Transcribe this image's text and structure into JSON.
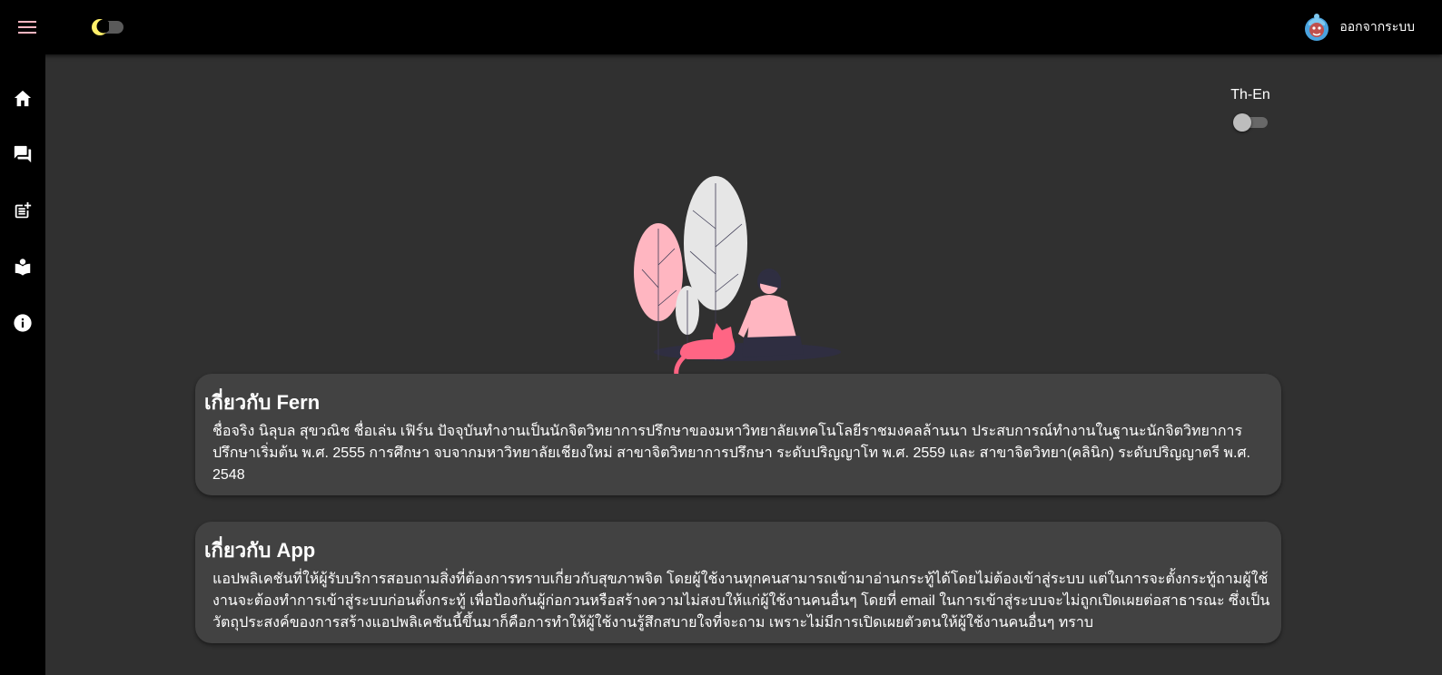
{
  "topbar": {
    "menu_icon": "menu-icon",
    "theme_toggle_icon": "moon-icon",
    "logout_label": "ออกจากระบบ"
  },
  "sidebar": {
    "items": [
      {
        "icon": "home-icon"
      },
      {
        "icon": "forum-icon"
      },
      {
        "icon": "post-add-icon"
      },
      {
        "icon": "local-library-icon"
      },
      {
        "icon": "info-icon"
      }
    ]
  },
  "language": {
    "label": "Th-En"
  },
  "about_fern": {
    "title": "เกี่ยวกับ Fern",
    "body": "ชื่อจริง นิลุบล สุขวณิช ชื่อเล่น เฟิร์น ปัจจุบันทำงานเป็นนักจิตวิทยาการปรึกษาของมหาวิทยาลัยเทคโนโลยีราชมงคลล้านนา ประสบการณ์ทำงานในฐานะนักจิตวิทยาการปรึกษาเริ่มต้น พ.ศ. 2555 การศึกษา จบจากมหาวิทยาลัยเชียงใหม่ สาขาจิตวิทยาการปรึกษา ระดับปริญญาโท พ.ศ. 2559 และ สาขาจิตวิทยา(คลินิก) ระดับปริญญาตรี พ.ศ. 2548"
  },
  "about_app": {
    "title": "เกี่ยวกับ App",
    "body": "แอปพลิเคชันที่ให้ผู้รับบริการสอบถามสิ่งที่ต้องการทราบเกี่ยวกับสุขภาพจิต โดยผู้ใช้งานทุกคนสามารถเข้ามาอ่านกระทู้ได้โดยไม่ต้องเข้าสู่ระบบ แต่ในการจะตั้งกระทู้ถามผู้ใช้งานจะต้องทำการเข้าสู่ระบบก่อนตั้งกระทู้ เพื่อป้องกันผู้ก่อกวนหรือสร้างความไม่สงบให้แก่ผู้ใช้งานคนอื่นๆ โดยที่ email ในการเข้าสู่ระบบจะไม่ถูกเปิดเผยต่อสาธารณะ ซึ่งเป็นวัตถุประสงค์ของการสร้างแอปพลิเคชันนี้ขึ้นมาก็คือการทำให้ผู้ใช้งานรู้สึกสบายใจที่จะถาม เพราะไม่มีการเปิดเผยตัวตนให้ผู้ใช้งานคนอื่นๆ ทราบ"
  },
  "colors": {
    "background": "#303030",
    "bars": "#000000",
    "card": "#424242",
    "accent_pink": "#ff6584",
    "leaf_pink": "#ffb6c1"
  }
}
